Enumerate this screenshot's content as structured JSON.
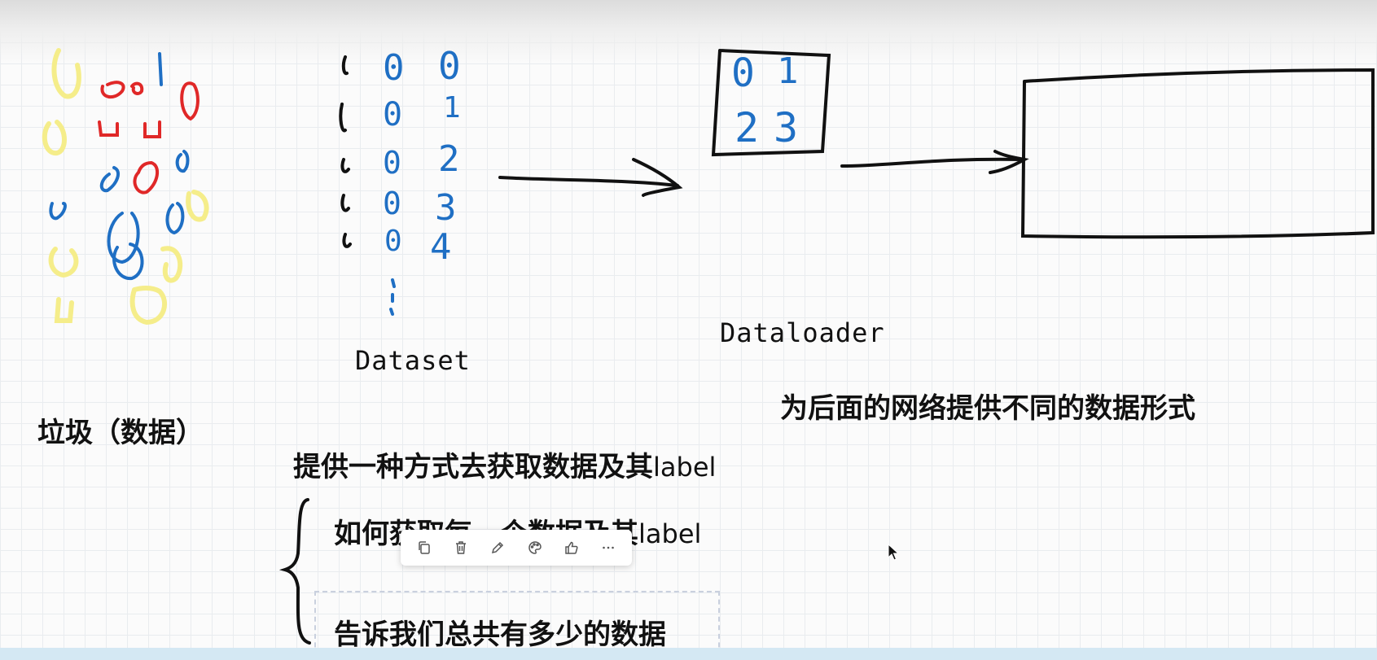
{
  "labels": {
    "dataset": "Dataset",
    "dataloader": "Dataloader"
  },
  "notes": {
    "garbage": "垃圾（数据）",
    "provide_main": "提供一种方式去获取数据及其",
    "provide_suffix": "label",
    "how_main": "如何获取每一个数据及其",
    "how_suffix": "label",
    "count": "告诉我们总共有多少的数据",
    "loader": "为后面的网络提供不同的数据形式"
  },
  "dataset_columns": {
    "col2": [
      "0",
      "0",
      "0",
      "0",
      "0"
    ],
    "col3": [
      "0",
      "1",
      "2",
      "3",
      "4"
    ]
  },
  "dataloader_box": [
    "0",
    "1",
    "2",
    "3"
  ],
  "toolbar": {
    "items": [
      {
        "name": "copy-icon"
      },
      {
        "name": "delete-icon"
      },
      {
        "name": "edit-icon"
      },
      {
        "name": "color-palette-icon"
      },
      {
        "name": "thumbs-up-icon"
      },
      {
        "name": "more-icon"
      }
    ]
  },
  "colors": {
    "yellow": "#f7ef8a",
    "red": "#e02828",
    "blue": "#1f6fc4",
    "ink": "#111111",
    "grid": "#e9ecef",
    "bottom_band": "#d4e8f3"
  }
}
